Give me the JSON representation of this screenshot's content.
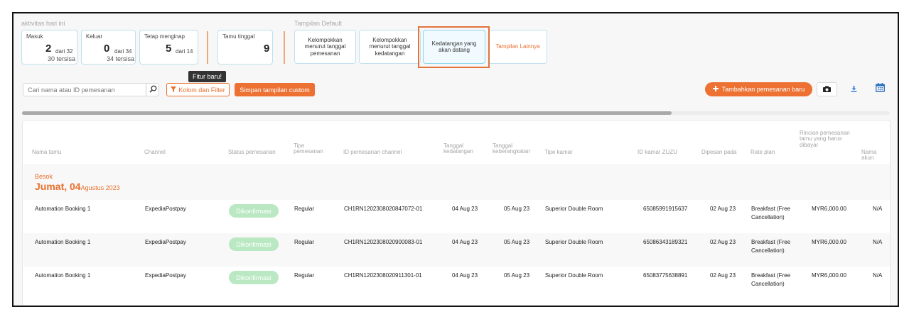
{
  "header": {
    "activity_label": "aktivitas hari ini",
    "views_label": "Tampilan Default"
  },
  "stats": {
    "masuk": {
      "title": "Masuk",
      "value": "2",
      "of": "dari 32",
      "remaining": "30 tersisa"
    },
    "keluar": {
      "title": "Keluar",
      "value": "0",
      "of": "dari 34",
      "remaining": "34 tersisa"
    },
    "menginap": {
      "title": "Tetap menginap",
      "value": "5",
      "of": "dari 14"
    },
    "tamu": {
      "title": "Tamu tinggal",
      "value": "9"
    }
  },
  "views": {
    "by_booking": "Kelompokkan menurut tanggal pemesanan",
    "by_arrival": "Kelompokkan menurut tanggal kedatangan",
    "upcoming": "Kedatangan yang akan datang",
    "more": "Tampilan Lainnya"
  },
  "toolbar": {
    "search_placeholder": "Cari nama atau ID pemesanan",
    "tooltip": "Fitur baru!",
    "filter_label": "Kolom dan Filter",
    "save_label": "Simpan tampilan custom",
    "add_label": "Tambahkan pemesanan baru"
  },
  "table": {
    "columns": {
      "guest": "Nama tamu",
      "channel": "Channel",
      "status": "Status pemesanan",
      "type": "Tipe pemesanan",
      "channel_id": "ID pemesanan channel",
      "arrival": "Tanggal kedatangan",
      "departure": "Tanggal keberangkatan",
      "room_type": "Tipe kamar",
      "room_id": "ID kamar ZUZU",
      "booked_on": "Dipesan pada",
      "rate_plan": "Rate plan",
      "amount": "Rincian pemesanan tamu yang harus dibayar",
      "account": "Nama akun"
    },
    "group": {
      "sub": "Besok",
      "day": "Jumat, 04",
      "month_year": "Agustus 2023"
    },
    "rows": [
      {
        "guest": "Automation Booking 1",
        "channel": "ExpediaPostpay",
        "status": "Dikonfirmasi",
        "type": "Regular",
        "channel_id": "CH1RN1202308020847072-01",
        "arrival": "04 Aug 23",
        "departure": "05 Aug 23",
        "room_type": "Superior Double Room",
        "room_id": "65085991915637",
        "booked_on": "02 Aug 23",
        "rate_plan": "Breakfast (Free Cancellation)",
        "amount": "MYR6,000.00",
        "account": "N/A"
      },
      {
        "guest": "Automation Booking 1",
        "channel": "ExpediaPostpay",
        "status": "Dikonfirmasi",
        "type": "Regular",
        "channel_id": "CH1RN1202308020900083-01",
        "arrival": "04 Aug 23",
        "departure": "05 Aug 23",
        "room_type": "Superior Double Room",
        "room_id": "65086343189321",
        "booked_on": "02 Aug 23",
        "rate_plan": "Breakfast (Free Cancellation)",
        "amount": "MYR6,000.00",
        "account": "N/A"
      },
      {
        "guest": "Automation Booking 1",
        "channel": "ExpediaPostpay",
        "status": "Dikonfirmasi",
        "type": "Regular",
        "channel_id": "CH1RN1202308020911301-01",
        "arrival": "04 Aug 23",
        "departure": "05 Aug 23",
        "room_type": "Superior Double Room",
        "room_id": "65083775638891",
        "booked_on": "02 Aug 23",
        "rate_plan": "Breakfast (Free Cancellation)",
        "amount": "MYR6,000.00",
        "account": "N/A"
      }
    ]
  },
  "colors": {
    "accent": "#ec7133",
    "badge": "#b9e8c2",
    "card_border": "#bfe0ef"
  },
  "icons": [
    "search-icon",
    "filter-icon",
    "plus-icon",
    "camera-icon",
    "download-icon",
    "calendar-icon"
  ]
}
